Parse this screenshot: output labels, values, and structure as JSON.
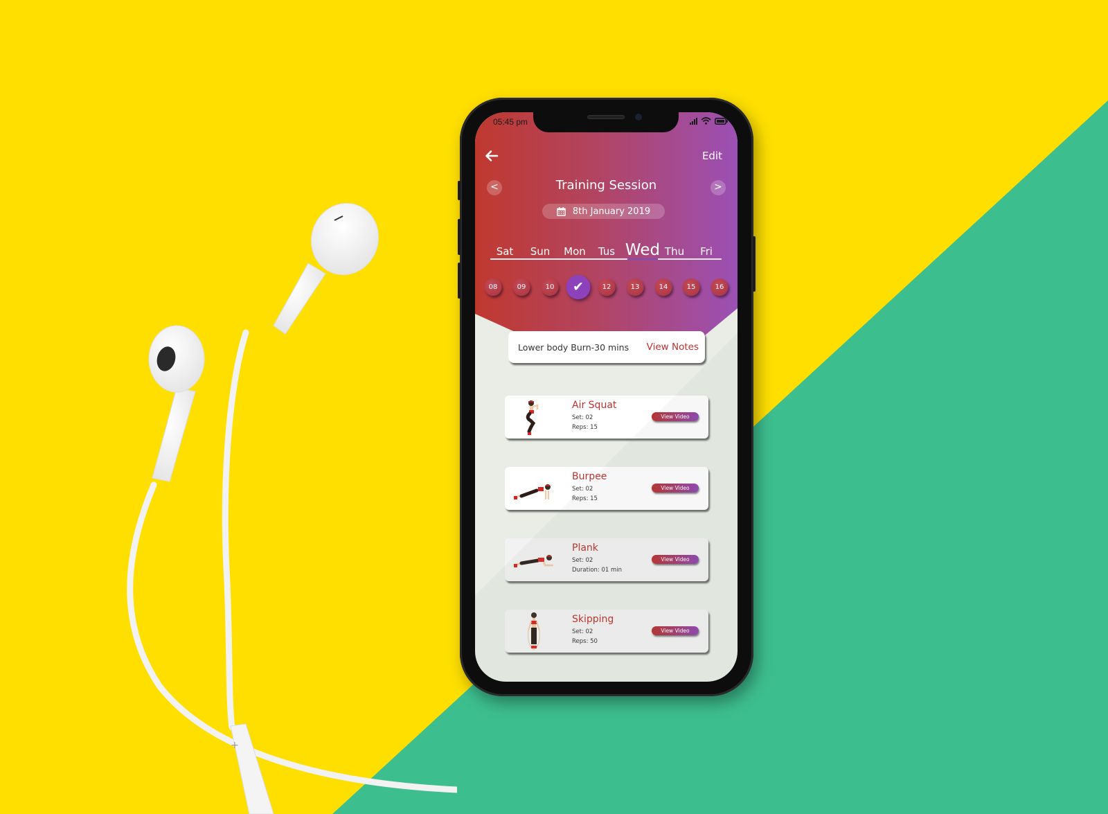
{
  "status_bar": {
    "time": "05:45 pm",
    "icons": [
      "signal-icon",
      "wifi-icon",
      "battery-icon"
    ]
  },
  "header": {
    "back_icon": "arrow-left-icon",
    "edit_label": "Edit",
    "title": "Training Session",
    "prev_label": "<",
    "next_label": ">",
    "date_icon": "calendar-icon",
    "date_label": "8th January 2019",
    "accent_colors": {
      "start": "#C0392F",
      "end": "#9B50B5"
    }
  },
  "week": {
    "days": [
      {
        "label": "Sat",
        "active": false
      },
      {
        "label": "Sun",
        "active": false
      },
      {
        "label": "Mon",
        "active": false
      },
      {
        "label": "Tus",
        "active": false
      },
      {
        "label": "Wed",
        "active": true
      },
      {
        "label": "Thu",
        "active": false
      },
      {
        "label": "Fri",
        "active": false
      }
    ],
    "dates": [
      {
        "label": "08",
        "selected": false
      },
      {
        "label": "09",
        "selected": false
      },
      {
        "label": "10",
        "selected": false
      },
      {
        "label": "✔",
        "selected": true
      },
      {
        "label": "12",
        "selected": false
      },
      {
        "label": "13",
        "selected": false
      },
      {
        "label": "14",
        "selected": false
      },
      {
        "label": "15",
        "selected": false
      },
      {
        "label": "16",
        "selected": false
      }
    ]
  },
  "session": {
    "summary": "Lower body Burn-30 mins",
    "view_notes_label": "View Notes"
  },
  "exercises": [
    {
      "name": "Air Squat",
      "set": "Set: 02",
      "detail": "Reps: 15",
      "button": "View Video",
      "figure": "squat-figure-icon"
    },
    {
      "name": "Burpee",
      "set": "Set: 02",
      "detail": "Reps: 15",
      "button": "View Video",
      "figure": "burpee-figure-icon"
    },
    {
      "name": "Plank",
      "set": "Set: 02",
      "detail": "Duration: 01 min",
      "button": "View Video",
      "figure": "plank-figure-icon"
    },
    {
      "name": "Skipping",
      "set": "Set: 02",
      "detail": "Reps: 50",
      "button": "View Video",
      "figure": "skipping-figure-icon"
    }
  ]
}
